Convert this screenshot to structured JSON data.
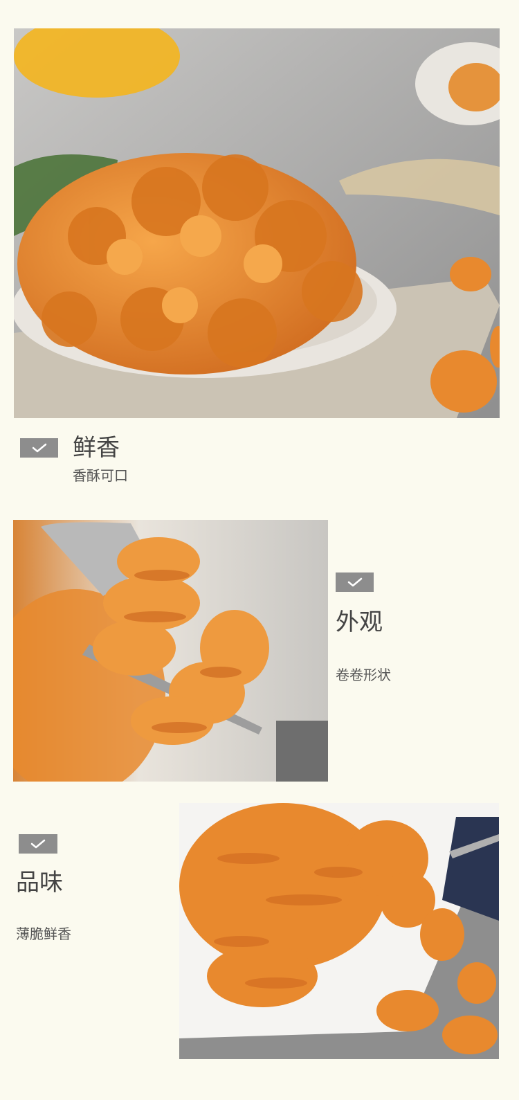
{
  "sections": [
    {
      "title": "鲜香",
      "subtitle": "香酥可口",
      "icon": "check-icon"
    },
    {
      "title": "外观",
      "subtitle": "卷卷形状",
      "icon": "check-icon"
    },
    {
      "title": "品味",
      "subtitle": "薄脆鲜香",
      "icon": "check-icon"
    }
  ],
  "colors": {
    "background": "#fbfaef",
    "badge": "#8d8d8d",
    "snack": "#e8892e",
    "snack_dark": "#c9621c",
    "text_title": "#444444",
    "text_sub": "#555555"
  }
}
